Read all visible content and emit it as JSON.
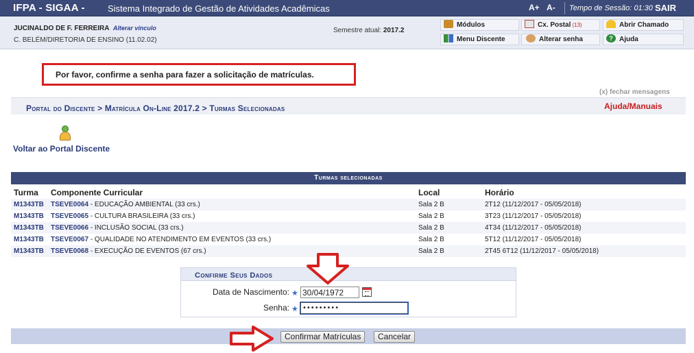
{
  "header": {
    "brand": "IFPA - SIGAA -",
    "system_title": "Sistema Integrado de Gestão de Atividades Acadêmicas",
    "font_increase": "A+",
    "font_decrease": "A-",
    "session_label": "Tempo de Sessão: 01:30",
    "logout": "SAIR"
  },
  "user": {
    "name": "JUCINALDO DE F. FERREIRA",
    "change_link": "Alterar vínculo",
    "unit": "C. BELÉM/DIRETORIA DE ENSINO (11.02.02)",
    "semester_label": "Semestre atual:",
    "semester_value": "2017.2"
  },
  "quick_links": {
    "modulos": "Módulos",
    "cx_postal": "Cx. Postal",
    "cx_postal_count": "(13)",
    "abrir_chamado": "Abrir Chamado",
    "menu_discente": "Menu Discente",
    "alterar_senha": "Alterar senha",
    "ajuda": "Ajuda"
  },
  "message": {
    "text": "Por favor, confirme a senha para fazer a solicitação de matrículas.",
    "close": "(x) fechar mensagens"
  },
  "breadcrumb": {
    "path": "Portal do Discente > Matrícula On-Line 2017.2 > Turmas Selecionadas",
    "help": "Ajuda/Manuais"
  },
  "back_link": {
    "label": "Voltar ao Portal Discente",
    "icon": "user-icon"
  },
  "table": {
    "caption": "Turmas selecionadas",
    "headers": [
      "Turma",
      "Componente Curricular",
      "Local",
      "Horário"
    ],
    "rows": [
      {
        "turma": "M1343TB",
        "code": "TSEVE0064",
        "name": "- EDUCAÇÃO AMBIENTAL (33 crs.)",
        "local": "Sala 2 B",
        "horario": "2T12 (11/12/2017 - 05/05/2018)"
      },
      {
        "turma": "M1343TB",
        "code": "TSEVE0065",
        "name": "- CULTURA BRASILEIRA (33 crs.)",
        "local": "Sala 2 B",
        "horario": "3T23 (11/12/2017 - 05/05/2018)"
      },
      {
        "turma": "M1343TB",
        "code": "TSEVE0066",
        "name": "- INCLUSÃO SOCIAL (33 crs.)",
        "local": "Sala 2 B",
        "horario": "4T34 (11/12/2017 - 05/05/2018)"
      },
      {
        "turma": "M1343TB",
        "code": "TSEVE0067",
        "name": "- QUALIDADE NO ATENDIMENTO EM EVENTOS (33 crs.)",
        "local": "Sala 2 B",
        "horario": "5T12 (11/12/2017 - 05/05/2018)"
      },
      {
        "turma": "M1343TB",
        "code": "TSEVE0068",
        "name": "- EXECUÇÃO DE EVENTOS (67 crs.)",
        "local": "Sala 2 B",
        "horario": "2T45 6T12 (11/12/2017 - 05/05/2018)"
      }
    ]
  },
  "confirm": {
    "title": "Confirme Seus Dados",
    "birth_label": "Data de Nascimento:",
    "birth_value": "30/04/1972",
    "password_label": "Senha:",
    "password_value": "•••••••••",
    "required_mark": "★"
  },
  "actions": {
    "confirm": "Confirmar Matrículas",
    "cancel": "Cancelar"
  },
  "colors": {
    "header_bg": "#3b4a78",
    "link": "#2a3b7a",
    "highlight_red": "#d62020"
  }
}
